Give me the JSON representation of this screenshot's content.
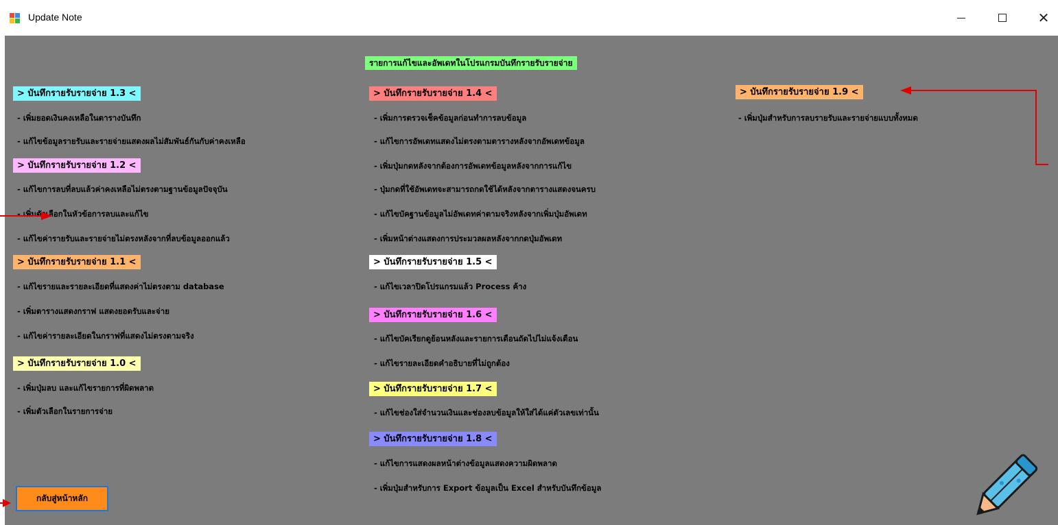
{
  "window": {
    "title": "Update Note",
    "controls": {
      "minimize": "—",
      "maximize": "☐",
      "close": "✕"
    }
  },
  "heading": "รายการแก้ไขและอัพเดทในโปรแกรมบันทึกรายรับรายจ่าย",
  "colors": {
    "background": "#7c7c7c",
    "heading_bg": "#7dff7d",
    "v1_3": "#7ff7ff",
    "v1_2": "#ffb8ff",
    "v1_1": "#ffb36b",
    "v1_0": "#ffffb0",
    "v1_4": "#ff7e7e",
    "v1_5": "#ffffff",
    "v1_6": "#ff7fff",
    "v1_7": "#ffff7f",
    "v1_8": "#8a8aff",
    "v1_9": "#ffb36b",
    "button_bg": "#ff8c1a",
    "annotation_arrow": "#e00000"
  },
  "sections": {
    "v1_3": {
      "label": "> บันทึกรายรับรายจ่าย 1.3 <",
      "items": [
        "- เพิ่มยอดเงินคงเหลือในตารางบันทึก",
        "- แก้ไขข้อมูลรายรับและรายจ่ายแสดงผลไม่สัมพันธ์กันกับค่าคงเหลือ"
      ]
    },
    "v1_2": {
      "label": "> บันทึกรายรับรายจ่าย 1.2 <",
      "items": [
        "- แก้ไขการลบที่ลบแล้วค่าคงเหลือไม่ตรงตามฐานข้อมูลปัจจุบัน",
        "- เพิ่มตัวเลือกในหัวข้อการลบและแก้ไข",
        "- แก้ไขค่ารายรับและรายจ่ายไม่ตรงหลังจากที่ลบข้อมูลออกแล้ว"
      ]
    },
    "v1_1": {
      "label": "> บันทึกรายรับรายจ่าย 1.1 <",
      "items": [
        "- แก้ไขรายและรายละเอียดที่แสดงค่าไม่ตรงตาม database",
        "- เพิ่มตารางแสดงกราฟ แสดงยอดรับและจ่าย",
        "- แก้ไขค่ารายละเอียดในกราฟที่แสดงไม่ตรงตามจริง"
      ]
    },
    "v1_0": {
      "label": "> บันทึกรายรับรายจ่าย 1.0 <",
      "items": [
        "- เพิ่มปุ่มลบ และแก้ไขรายการที่ผิดพลาด",
        "- เพิ่มตัวเลือกในรายการจ่าย"
      ]
    },
    "v1_4": {
      "label": "> บันทึกรายรับรายจ่าย 1.4 <",
      "items": [
        "- เพิ่มการตรวจเช็คข้อมูลก่อนทำการลบข้อมูล",
        "- แก้ไขการอัพเดทแสดงไม่ตรงตามตารางหลังจากอัพเดทข้อมูล",
        "- เพิ่มปุ่มกดหลังจากต้องการอัพเดทข้อมูลหลังจากการแก้ไข",
        "- ปุ่มกดที่ใช้อัพเดทจะสามารถกดใช้ได้หลังจากตารางแสดงจนครบ",
        "- แก้ไขบัคฐานข้อมูลไม่อัพเดทค่าตามจริงหลังจากเพิ่มปุ่มอัพเดท",
        "- เพิ่มหน้าต่างแสดงการประมวลผลหลังจากกดปุ่มอัพเดท"
      ]
    },
    "v1_5": {
      "label": "> บันทึกรายรับรายจ่าย 1.5 <",
      "items": [
        "- แก้ไขเวลาปิดโปรแกรมแล้ว Process ค้าง"
      ]
    },
    "v1_6": {
      "label": "> บันทึกรายรับรายจ่าย 1.6 <",
      "items": [
        "- แก้ไขบัคเรียกดูย้อนหลังและรายการเดือนถัดไปไม่แจ้งเตือน",
        "- แก้ไขรายละเอียดคำอธิบายที่ไม่ถูกต้อง"
      ]
    },
    "v1_7": {
      "label": "> บันทึกรายรับรายจ่าย 1.7 <",
      "items": [
        "- แก้ไขช่องใส่จำนวนเงินและช่องลบข้อมูลให้ใส่ได้แค่ตัวเลขเท่านั้น"
      ]
    },
    "v1_8": {
      "label": "> บันทึกรายรับรายจ่าย 1.8 <",
      "items": [
        "- แก้ไขการแสดงผลหน้าต่างข้อมูลแสดงความผิดพลาด",
        "- เพิ่มปุ่มสำหรับการ Export ข้อมูลเป็น Excel สำหรับบันทึกข้อมูล"
      ]
    },
    "v1_9": {
      "label": "> บันทึกรายรับรายจ่าย 1.9 <",
      "items": [
        "- เพิ่มปุ่มสำหรับการลบรายรับและรายจ่ายแบบทั้งหมด"
      ]
    }
  },
  "home_button": "กลับสู่หน้าหลัก",
  "icons": {
    "app": "app-icon",
    "decoration": "pencil-icon"
  }
}
